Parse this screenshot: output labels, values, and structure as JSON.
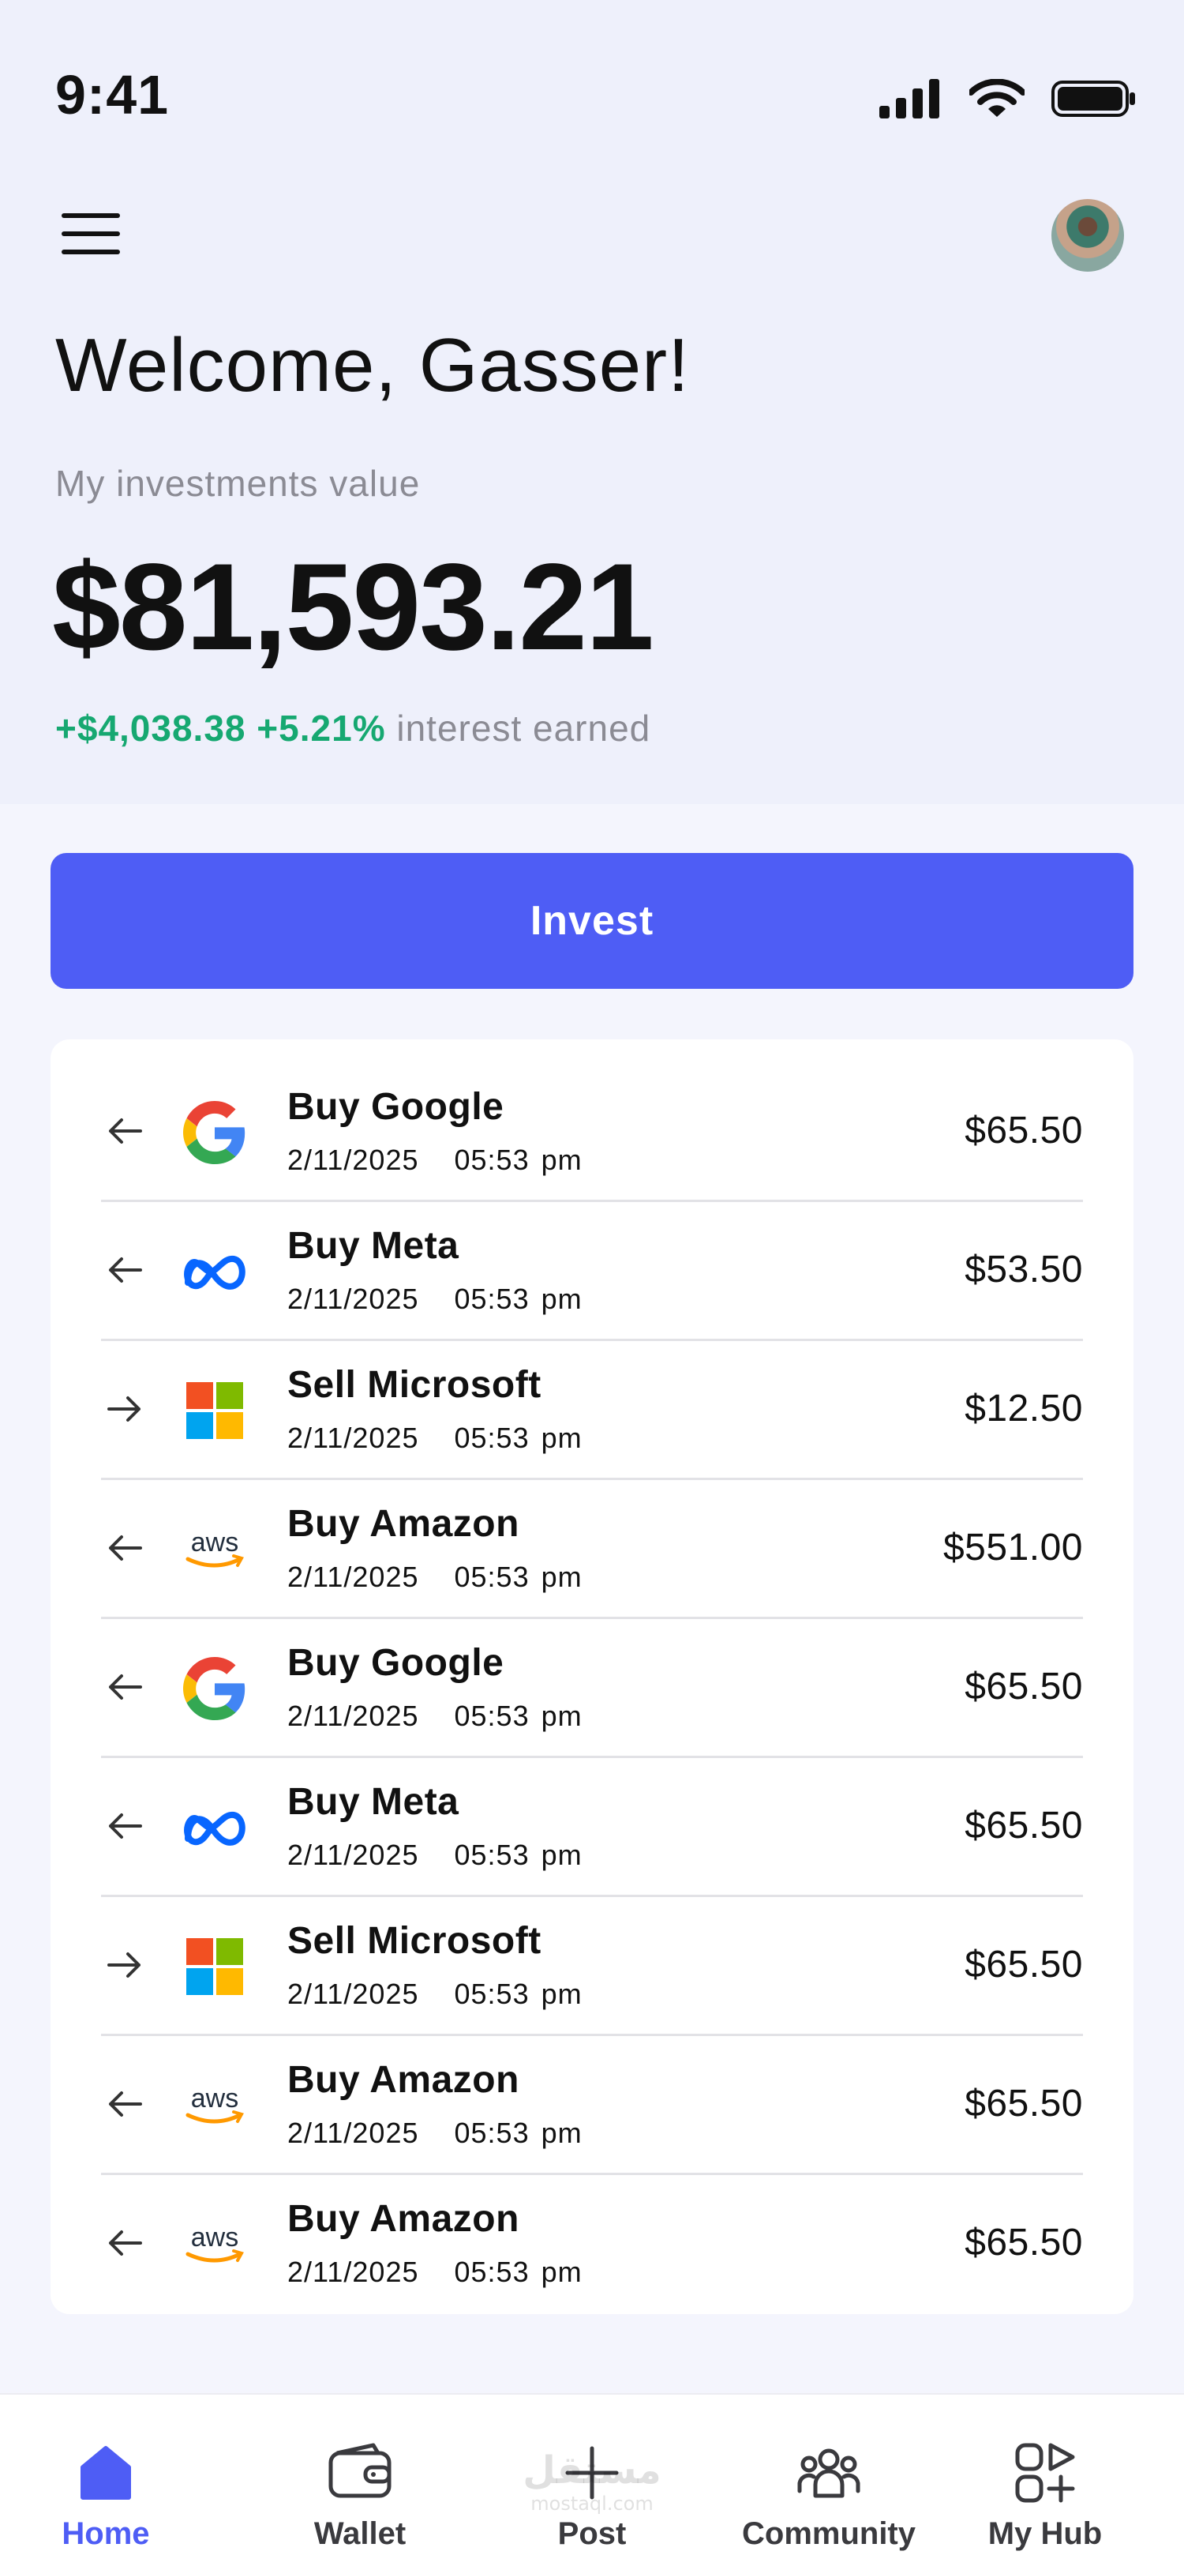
{
  "status_bar": {
    "time": "9:41"
  },
  "header": {
    "welcome": "Welcome, Gasser!",
    "investments_label": "My investments value",
    "investments_value": "$81,593.21",
    "interest_amount": "+$4,038.38",
    "interest_percent": "+5.21%",
    "interest_suffix": "interest earned"
  },
  "invest_button": {
    "label": "Invest"
  },
  "transactions": [
    {
      "direction": "in",
      "logo": "google-logo",
      "title": "Buy Google",
      "date": "2/11/2025",
      "time": "05:53 pm",
      "amount": "$65.50"
    },
    {
      "direction": "in",
      "logo": "meta-logo",
      "title": "Buy Meta",
      "date": "2/11/2025",
      "time": "05:53 pm",
      "amount": "$53.50"
    },
    {
      "direction": "out",
      "logo": "microsoft-logo",
      "title": "Sell Microsoft",
      "date": "2/11/2025",
      "time": "05:53 pm",
      "amount": "$12.50"
    },
    {
      "direction": "in",
      "logo": "aws-logo",
      "title": "Buy Amazon",
      "date": "2/11/2025",
      "time": "05:53 pm",
      "amount": "$551.00"
    },
    {
      "direction": "in",
      "logo": "google-logo",
      "title": "Buy Google",
      "date": "2/11/2025",
      "time": "05:53 pm",
      "amount": "$65.50"
    },
    {
      "direction": "in",
      "logo": "meta-logo",
      "title": "Buy Meta",
      "date": "2/11/2025",
      "time": "05:53 pm",
      "amount": "$65.50"
    },
    {
      "direction": "out",
      "logo": "microsoft-logo",
      "title": "Sell Microsoft",
      "date": "2/11/2025",
      "time": "05:53 pm",
      "amount": "$65.50"
    },
    {
      "direction": "in",
      "logo": "aws-logo",
      "title": "Buy Amazon",
      "date": "2/11/2025",
      "time": "05:53 pm",
      "amount": "$65.50"
    },
    {
      "direction": "in",
      "logo": "aws-logo",
      "title": "Buy Amazon",
      "date": "2/11/2025",
      "time": "05:53 pm",
      "amount": "$65.50"
    }
  ],
  "tabbar": [
    {
      "label": "Home",
      "icon": "home-icon",
      "active": true
    },
    {
      "label": "Wallet",
      "icon": "wallet-icon",
      "active": false
    },
    {
      "label": "Post",
      "icon": "plus-icon",
      "active": false
    },
    {
      "label": "Community",
      "icon": "community-icon",
      "active": false
    },
    {
      "label": "My Hub",
      "icon": "hub-icon",
      "active": false
    }
  ],
  "watermark": {
    "text": "مستقل",
    "subtext": "mostaql.com"
  },
  "colors": {
    "accent": "#4e5df5",
    "positive": "#16a871",
    "muted": "#8b8b94",
    "header_bg": "#eef0fb"
  }
}
